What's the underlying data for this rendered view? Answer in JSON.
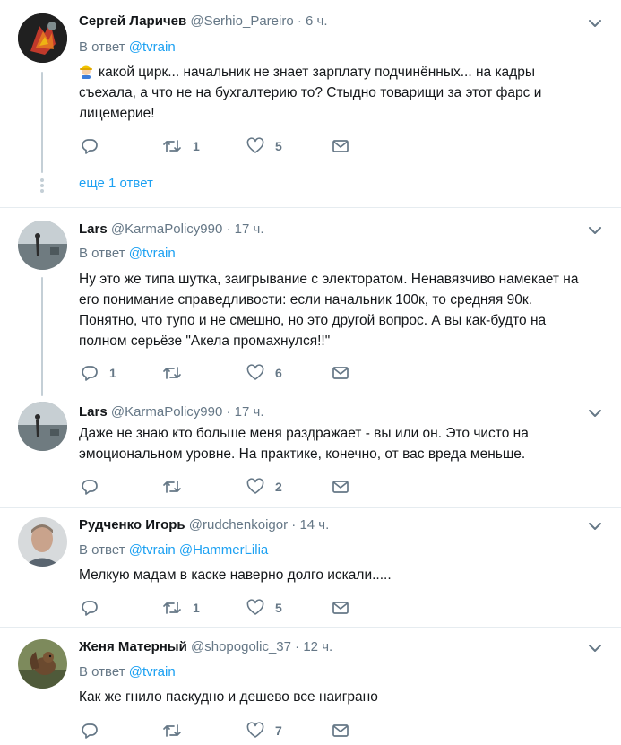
{
  "tweets": [
    {
      "name": "Сергей Ларичев",
      "handle": "@Serhio_Pareiro",
      "time": "6 ч.",
      "reply_label": "В ответ",
      "reply_links": [
        "@tvrain"
      ],
      "text_lines": [
        "какой цирк... начальник не знает зарплату подчинённых... на кадры",
        "съехала, а что не на бухгалтерию то? Стыдно товарищи за этот фарс и",
        "лицемерие!"
      ],
      "replies": "",
      "retweets": "1",
      "likes": "5",
      "more_replies": "еще 1 ответ"
    },
    {
      "name": "Lars",
      "handle": "@KarmaPolicy990",
      "time": "17 ч.",
      "reply_label": "В ответ",
      "reply_links": [
        "@tvrain"
      ],
      "text_lines": [
        "Ну это же типа шутка, заигрывание с электоратом. Ненавязчиво намекает на",
        "его понимание справедливости: если начальник 100к, то средняя 90к.",
        "Понятно, что тупо и не смешно, но это другой вопрос. А вы как-будто на",
        "полном серьёзе \"Акела промахнулся!!\""
      ],
      "replies": "1",
      "retweets": "",
      "likes": "6"
    },
    {
      "name": "Lars",
      "handle": "@KarmaPolicy990",
      "time": "17 ч.",
      "text_lines": [
        "Даже не знаю кто больше меня раздражает - вы или он. Это чисто на",
        "эмоциональном уровне. На практике, конечно, от вас вреда меньше."
      ],
      "replies": "",
      "retweets": "",
      "likes": "2"
    },
    {
      "name": "Рудченко Игорь",
      "handle": "@rudchenkoigor",
      "time": "14 ч.",
      "reply_label": "В ответ",
      "reply_links": [
        "@tvrain",
        "@HammerLilia"
      ],
      "text_lines": [
        "Мелкую мадам в каске наверно долго искали....."
      ],
      "replies": "",
      "retweets": "1",
      "likes": "5"
    },
    {
      "name": "Женя Матерный",
      "handle": "@shopogolic_37",
      "time": "12 ч.",
      "reply_label": "В ответ",
      "reply_links": [
        "@tvrain"
      ],
      "text_lines": [
        "Как же гнило паскудно и дешево все наиграно"
      ],
      "replies": "",
      "retweets": "",
      "likes": "7"
    }
  ],
  "separator": "·",
  "colors": {
    "text": "#14171a",
    "secondary": "#657786",
    "link": "#1da1f2",
    "thread_line": "#c4cfd6",
    "divider": "#e6ecf0"
  },
  "icons": [
    "reply-icon",
    "retweet-icon",
    "like-icon",
    "message-icon",
    "chevron-down-icon"
  ]
}
